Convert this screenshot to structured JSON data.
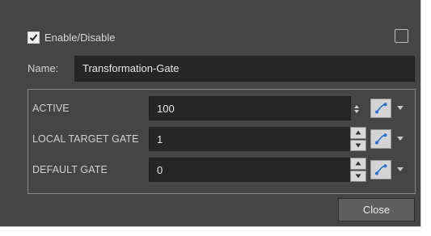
{
  "enable": {
    "label": "Enable/Disable",
    "checked": true
  },
  "name": {
    "label": "Name:",
    "value": "Transformation-Gate"
  },
  "params": [
    {
      "label": "ACTIVE",
      "value": "100"
    },
    {
      "label": "LOCAL TARGET GATE",
      "value": "1"
    },
    {
      "label": "DEFAULT GATE",
      "value": "0"
    }
  ],
  "close_label": "Close",
  "icons": {
    "function": "function-curve-icon",
    "dropdown": "triangle-down-icon",
    "spin": "spinner-arrows-icon"
  },
  "colors": {
    "dialog_bg": "#454545",
    "field_bg": "#262626",
    "curve_blue": "#2a6fd6"
  }
}
